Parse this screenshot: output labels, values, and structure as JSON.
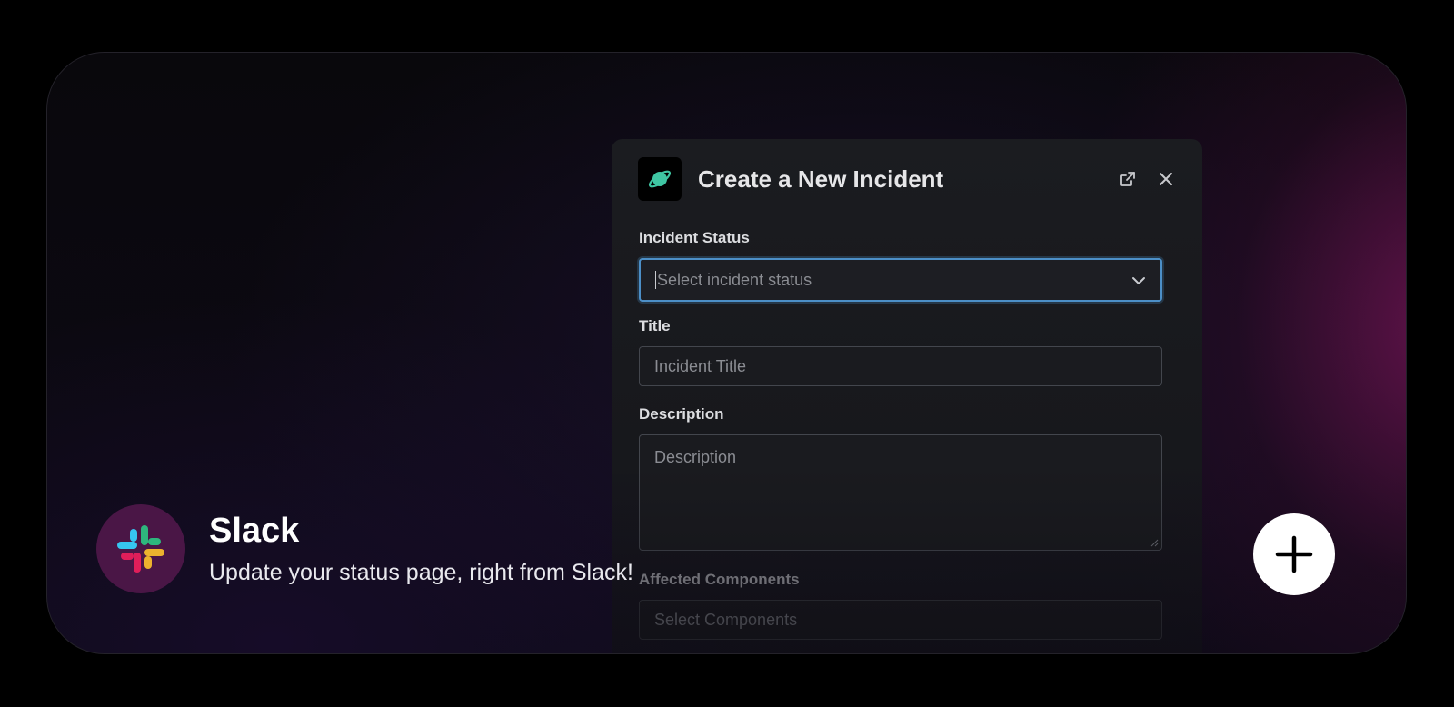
{
  "modal": {
    "title": "Create a New Incident",
    "app_icon": "planet-icon",
    "header_actions": [
      "external-link-icon",
      "close-icon"
    ],
    "fields": {
      "incident_status": {
        "label": "Incident Status",
        "placeholder": "Select incident status",
        "type": "select"
      },
      "title": {
        "label": "Title",
        "placeholder": "Incident Title"
      },
      "description": {
        "label": "Description",
        "placeholder": "Description"
      },
      "affected_components": {
        "label": "Affected Components",
        "placeholder": "Select Components"
      }
    }
  },
  "integration": {
    "name": "Slack",
    "tagline": "Update your status page, right from Slack!",
    "logo": "slack-logo",
    "add_button_icon": "plus-icon"
  },
  "colors": {
    "accent_focus": "#4c8fc7",
    "slack_badge_bg": "#4a1646",
    "slack_teal": "#36c5f0",
    "slack_green": "#2eb67d",
    "slack_red": "#e01e5a",
    "slack_yellow": "#ecb22e"
  }
}
